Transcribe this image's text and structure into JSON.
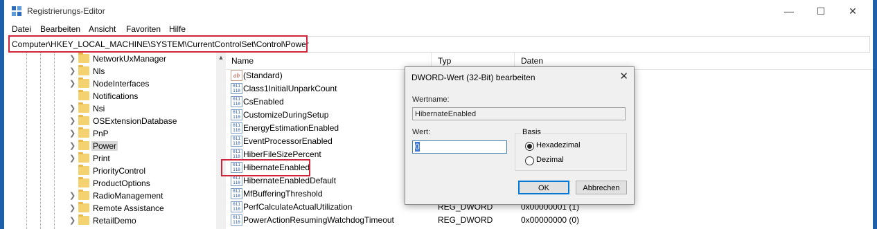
{
  "window": {
    "title": "Registrierungs-Editor"
  },
  "title_controls": {
    "minimize": "—",
    "maximize": "☐",
    "close": "✕"
  },
  "menu": [
    "Datei",
    "Bearbeiten",
    "Ansicht",
    "Favoriten",
    "Hilfe"
  ],
  "address": "Computer\\HKEY_LOCAL_MACHINE\\SYSTEM\\CurrentControlSet\\Control\\Power",
  "tree": {
    "items": [
      {
        "label": "NetworkUxManager"
      },
      {
        "label": "Nls"
      },
      {
        "label": "NodeInterfaces"
      },
      {
        "label": "Notifications"
      },
      {
        "label": "Nsi"
      },
      {
        "label": "OSExtensionDatabase"
      },
      {
        "label": "PnP"
      },
      {
        "label": "Power",
        "selected": true
      },
      {
        "label": "Print"
      },
      {
        "label": "PriorityControl"
      },
      {
        "label": "ProductOptions"
      },
      {
        "label": "RadioManagement"
      },
      {
        "label": "Remote Assistance"
      },
      {
        "label": "RetailDemo"
      }
    ]
  },
  "list": {
    "headers": {
      "name": "Name",
      "type": "Typ",
      "data": "Daten"
    },
    "rows": [
      {
        "name": "(Standard)",
        "type": "",
        "data": "",
        "icon": "string-value-icon"
      },
      {
        "name": "Class1InitialUnparkCount",
        "type": "",
        "data": "",
        "icon": "dword-value-icon"
      },
      {
        "name": "CsEnabled",
        "type": "",
        "data": "",
        "icon": "dword-value-icon"
      },
      {
        "name": "CustomizeDuringSetup",
        "type": "",
        "data": "",
        "icon": "dword-value-icon"
      },
      {
        "name": "EnergyEstimationEnabled",
        "type": "",
        "data": "",
        "icon": "dword-value-icon"
      },
      {
        "name": "EventProcessorEnabled",
        "type": "",
        "data": "",
        "icon": "dword-value-icon"
      },
      {
        "name": "HiberFileSizePercent",
        "type": "",
        "data": "",
        "icon": "dword-value-icon"
      },
      {
        "name": "HibernateEnabled",
        "type": "",
        "data": "",
        "icon": "dword-value-icon",
        "highlighted": true
      },
      {
        "name": "HibernateEnabledDefault",
        "type": "",
        "data": "",
        "icon": "dword-value-icon"
      },
      {
        "name": "MfBufferingThreshold",
        "type": "",
        "data": "",
        "icon": "dword-value-icon"
      },
      {
        "name": "PerfCalculateActualUtilization",
        "type": "REG_DWORD",
        "data": "0x00000001 (1)",
        "icon": "dword-value-icon"
      },
      {
        "name": "PowerActionResumingWatchdogTimeout",
        "type": "REG_DWORD",
        "data": "0x00000000 (0)",
        "icon": "dword-value-icon"
      }
    ]
  },
  "dialog": {
    "title": "DWORD-Wert (32-Bit) bearbeiten",
    "name_label": "Wertname:",
    "name_value": "HibernateEnabled",
    "value_label": "Wert:",
    "value": "0",
    "basis_label": "Basis",
    "basis_options": [
      "Hexadezimal",
      "Dezimal"
    ],
    "basis_selected": "Hexadezimal",
    "ok_label": "OK",
    "cancel_label": "Abbrechen",
    "close_glyph": "✕"
  },
  "colors": {
    "highlight_box": "#d1243a",
    "desktop": "#1d5fa8",
    "selection": "#3875d7"
  }
}
